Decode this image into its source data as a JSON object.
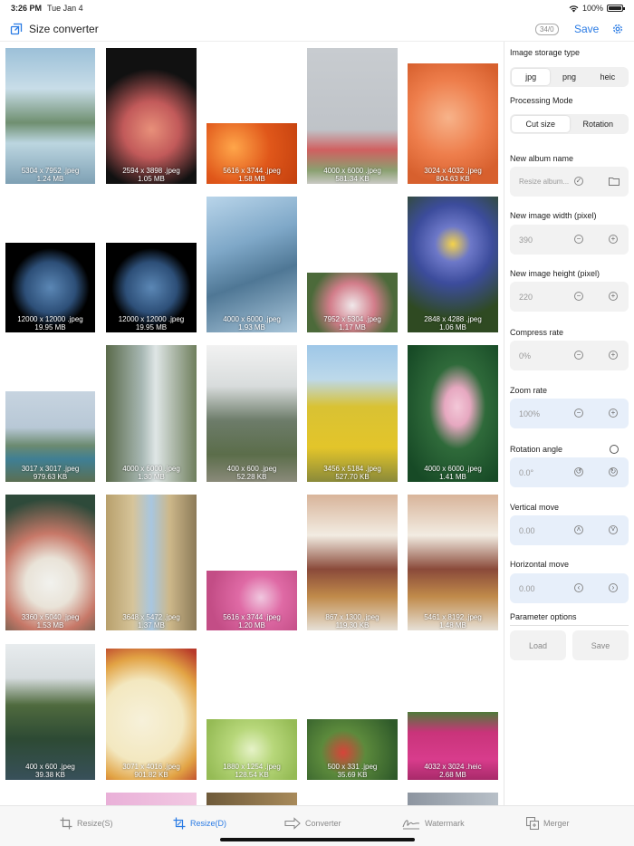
{
  "status": {
    "time": "3:26 PM",
    "date": "Tue Jan 4",
    "battery": "100%"
  },
  "nav": {
    "title": "Size converter",
    "counter": "34/0",
    "save_label": "Save"
  },
  "colors": {
    "accent": "#2a7be4"
  },
  "photos": [
    {
      "dims": "5304 x 7952",
      "ext": ".jpeg",
      "size": "1.24 MB"
    },
    {
      "dims": "2594 x 3898",
      "ext": ".jpeg",
      "size": "1.05 MB"
    },
    {
      "dims": "5616 x 3744",
      "ext": ".jpeg",
      "size": "1.58 MB"
    },
    {
      "dims": "4000 x 6000",
      "ext": ".jpeg",
      "size": "581.34 KB"
    },
    {
      "dims": "3024 x 4032",
      "ext": ".jpeg",
      "size": "804.63 KB"
    },
    {
      "dims": "12000 x 12000",
      "ext": ".jpeg",
      "size": "19.95 MB"
    },
    {
      "dims": "12000 x 12000",
      "ext": ".jpeg",
      "size": "19.95 MB"
    },
    {
      "dims": "4000 x 6000",
      "ext": ".jpeg",
      "size": "1.93 MB"
    },
    {
      "dims": "7952 x 5304",
      "ext": ".jpeg",
      "size": "1.17 MB"
    },
    {
      "dims": "2848 x 4288",
      "ext": ".jpeg",
      "size": "1.06 MB"
    },
    {
      "dims": "3017 x 3017",
      "ext": ".jpeg",
      "size": "979.63 KB"
    },
    {
      "dims": "4000 x 6000",
      "ext": ".jpeg",
      "size": "1.30 MB"
    },
    {
      "dims": "400 x 600",
      "ext": ".jpeg",
      "size": "52.28 KB"
    },
    {
      "dims": "3456 x 5184",
      "ext": ".jpeg",
      "size": "527.70 KB"
    },
    {
      "dims": "4000 x 6000",
      "ext": ".jpeg",
      "size": "1.41 MB"
    },
    {
      "dims": "3360 x 5040",
      "ext": ".jpeg",
      "size": "1.53 MB"
    },
    {
      "dims": "3648 x 5472",
      "ext": ".jpeg",
      "size": "1.37 MB"
    },
    {
      "dims": "5616 x 3744",
      "ext": ".jpeg",
      "size": "1.20 MB"
    },
    {
      "dims": "867 x 1300",
      "ext": ".jpeg",
      "size": "119.30 KB"
    },
    {
      "dims": "5461 x 8192",
      "ext": ".jpeg",
      "size": "1.48 MB"
    },
    {
      "dims": "400 x 600",
      "ext": ".jpeg",
      "size": "39.38 KB"
    },
    {
      "dims": "3071 x 4016",
      "ext": ".jpeg",
      "size": "901.82 KB"
    },
    {
      "dims": "1880 x 1254",
      "ext": ".jpeg",
      "size": "128.54 KB"
    },
    {
      "dims": "500 x 331",
      "ext": ".jpeg",
      "size": "35.69 KB"
    },
    {
      "dims": "4032 x 3024",
      "ext": ".heic",
      "size": "2.68 MB"
    }
  ],
  "panel": {
    "storage_label": "Image storage type",
    "storage_options": [
      "jpg",
      "png",
      "heic"
    ],
    "mode_label": "Processing Mode",
    "mode_options": [
      "Cut size",
      "Rotation"
    ],
    "album_label": "New album name",
    "album_placeholder": "Resize album...",
    "width_label": "New image width (pixel)",
    "width_value": "390",
    "height_label": "New image height (pixel)",
    "height_value": "220",
    "compress_label": "Compress rate",
    "compress_value": "0%",
    "zoom_label": "Zoom rate",
    "zoom_value": "100%",
    "rotation_label": "Rotation angle",
    "rotation_value": "0.0°",
    "vmove_label": "Vertical move",
    "vmove_value": "0.00",
    "hmove_label": "Horizontal move",
    "hmove_value": "0.00",
    "params_label": "Parameter options",
    "load_label": "Load",
    "save_label": "Save"
  },
  "tabs": [
    {
      "label": "Resize(S)",
      "icon": "crop-icon"
    },
    {
      "label": "Resize(D)",
      "icon": "crop-icon"
    },
    {
      "label": "Converter",
      "icon": "convert-icon"
    },
    {
      "label": "Watermark",
      "icon": "signature-icon"
    },
    {
      "label": "Merger",
      "icon": "merge-icon"
    }
  ]
}
